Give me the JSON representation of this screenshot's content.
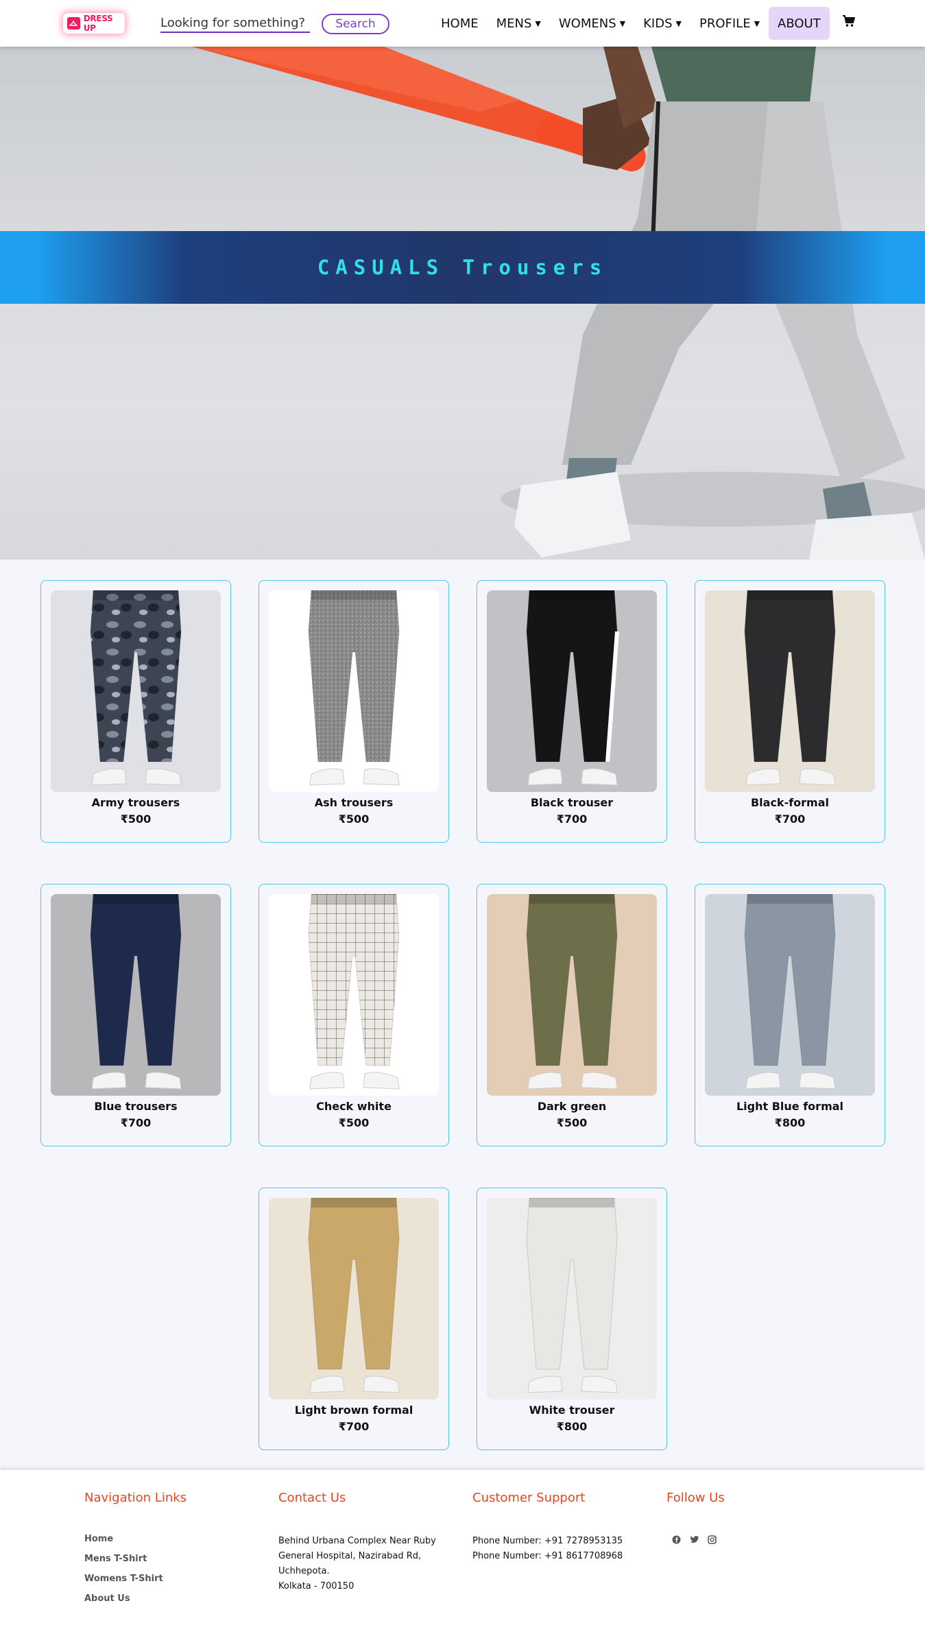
{
  "navbar": {
    "logo_text": "DRESS UP",
    "search_placeholder": "Looking for something?",
    "search_button": "Search",
    "links": [
      {
        "label": "HOME",
        "has_caret": false
      },
      {
        "label": "MENS",
        "has_caret": true
      },
      {
        "label": "WOMENS",
        "has_caret": true
      },
      {
        "label": "KIDS",
        "has_caret": true
      },
      {
        "label": "PROFILE",
        "has_caret": true
      },
      {
        "label": "ABOUT",
        "has_caret": false,
        "active": true
      }
    ],
    "cart_icon": "cart-icon"
  },
  "hero": {
    "banner_title": "CASUALS Trousers"
  },
  "products": [
    {
      "name": "Army trousers",
      "price": "₹500",
      "pants_color": "#3d4552",
      "bg": "#dfe1e7",
      "pattern": "camo"
    },
    {
      "name": "Ash trousers",
      "price": "₹500",
      "pants_color": "#8a8a8a",
      "bg": "#ffffff",
      "pattern": "heather"
    },
    {
      "name": "Black trouser",
      "price": "₹700",
      "pants_color": "#151515",
      "bg": "#c3c1c6",
      "pattern": "stripe"
    },
    {
      "name": "Black-formal",
      "price": "₹700",
      "pants_color": "#2c2c2e",
      "bg": "#e8e2d6",
      "pattern": "plain"
    },
    {
      "name": "Blue trousers",
      "price": "₹700",
      "pants_color": "#1d2a4c",
      "bg": "#b8b8bb",
      "pattern": "plain"
    },
    {
      "name": "Check white",
      "price": "₹500",
      "pants_color": "#ece8e3",
      "bg": "#ffffff",
      "pattern": "check"
    },
    {
      "name": "Dark green",
      "price": "₹500",
      "pants_color": "#6d6f4a",
      "bg": "#e4cdb6",
      "pattern": "plain"
    },
    {
      "name": "Light Blue formal",
      "price": "₹800",
      "pants_color": "#8a96a3",
      "bg": "#cfd5dc",
      "pattern": "plain"
    },
    {
      "name": "Light brown formal",
      "price": "₹700",
      "pants_color": "#caa869",
      "bg": "#ebe4d4",
      "pattern": "plain"
    },
    {
      "name": "White trouser",
      "price": "₹800",
      "pants_color": "#e7e7e3",
      "bg": "#ededed",
      "pattern": "plain"
    }
  ],
  "footer": {
    "navigation": {
      "heading": "Navigation Links",
      "links": [
        "Home",
        "Mens T-Shirt",
        "Womens T-Shirt",
        "About Us"
      ]
    },
    "contact": {
      "heading": "Contact Us",
      "lines": [
        "Behind Urbana Complex Near Ruby",
        "General Hospital, Nazirabad Rd,",
        "Uchhepota.",
        "Kolkata - 700150"
      ]
    },
    "support": {
      "heading": "Customer Support",
      "lines": [
        "Phone Number: +91 7278953135",
        "Phone Number: +91 8617708968"
      ]
    },
    "follow": {
      "heading": "Follow Us",
      "icons": [
        "facebook-icon",
        "twitter-icon",
        "instagram-icon"
      ]
    }
  }
}
